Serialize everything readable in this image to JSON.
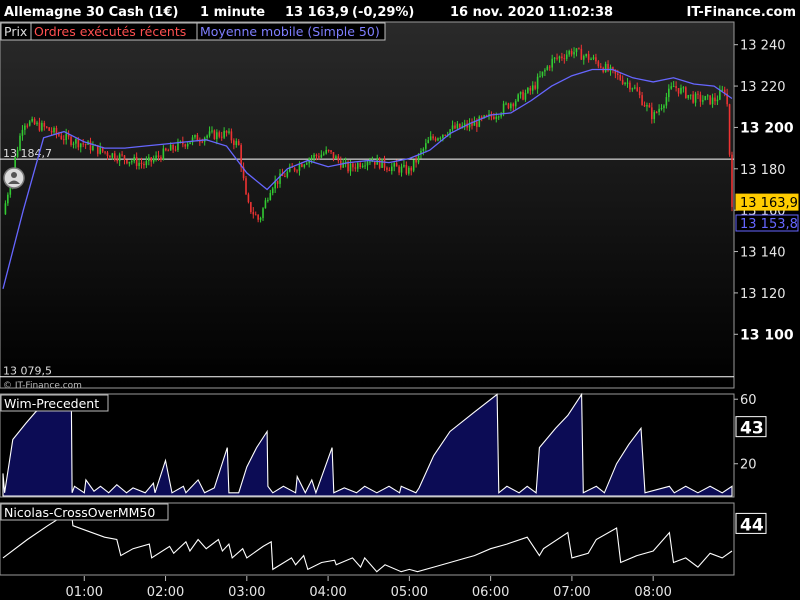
{
  "header": {
    "instrument": "Allemagne 30 Cash (1€)",
    "timeframe": "1 minute",
    "last": "13 163,9",
    "change": "(-0,29%)",
    "datetime": "16 nov. 2020 11:02:38",
    "brand": "IT-Finance.com"
  },
  "legend": {
    "price": "Prix",
    "orders": "Ordres exécutés récents",
    "ma": "Moyenne mobile (Simple 50)"
  },
  "colors": {
    "background": "#000000",
    "up_candle": "#33cc33",
    "down_candle": "#ee3333",
    "ma_line": "#6666ff",
    "orders_label": "#ff5050",
    "ma_label": "#7f7fff",
    "price_tag": "#ffcc00",
    "ma_tag": "#6666ff",
    "osc_fill": "#0c0c55"
  },
  "icons": {
    "orders_marker": "person-icon"
  },
  "copyright": "© IT-Finance.com",
  "chart_data": [
    {
      "type": "line",
      "title": "Allemagne 30 Cash (1€) · 1 minute",
      "ylim": [
        13075,
        13250
      ],
      "y_ticks": [
        "13 240",
        "13 220",
        "13 200",
        "13 180",
        "13 160",
        "13 140",
        "13 120",
        "13 100"
      ],
      "y_tick_values": [
        13240,
        13220,
        13200,
        13180,
        13160,
        13140,
        13120,
        13100
      ],
      "bold_ticks": [
        13200,
        13100
      ],
      "x_ticks": [
        "01:00",
        "02:00",
        "03:00",
        "04:00",
        "05:00",
        "06:00",
        "07:00",
        "08:00"
      ],
      "x_tick_hours": [
        1,
        2,
        3,
        4,
        5,
        6,
        7,
        8
      ],
      "x_range_hours": [
        0.0,
        8.97
      ],
      "series": [
        {
          "name": "Prix",
          "x_hours": [
            0.0,
            0.25,
            0.5,
            0.75,
            1.0,
            1.25,
            1.5,
            1.75,
            2.0,
            2.25,
            2.5,
            2.75,
            2.9,
            3.0,
            3.15,
            3.3,
            3.5,
            3.75,
            4.0,
            4.25,
            4.5,
            4.75,
            5.0,
            5.25,
            5.5,
            5.75,
            6.0,
            6.25,
            6.5,
            6.75,
            7.0,
            7.25,
            7.5,
            7.75,
            8.0,
            8.25,
            8.5,
            8.75,
            8.9,
            8.97
          ],
          "values": [
            13158,
            13203,
            13200,
            13195,
            13192,
            13188,
            13185,
            13182,
            13188,
            13193,
            13196,
            13197,
            13191,
            13163,
            13155,
            13172,
            13178,
            13185,
            13188,
            13180,
            13185,
            13181,
            13179,
            13194,
            13199,
            13201,
            13205,
            13212,
            13218,
            13232,
            13237,
            13233,
            13226,
            13220,
            13205,
            13220,
            13214,
            13213,
            13219,
            13164
          ]
        },
        {
          "name": "Moyenne mobile (Simple 50)",
          "x_hours": [
            0.0,
            0.25,
            0.5,
            0.75,
            1.0,
            1.25,
            1.5,
            1.75,
            2.0,
            2.25,
            2.5,
            2.75,
            3.0,
            3.25,
            3.5,
            3.75,
            4.0,
            4.25,
            4.5,
            4.75,
            5.0,
            5.25,
            5.5,
            5.75,
            6.0,
            6.25,
            6.5,
            6.75,
            7.0,
            7.25,
            7.5,
            7.75,
            8.0,
            8.25,
            8.5,
            8.75,
            8.97
          ],
          "values": [
            13122,
            13160,
            13195,
            13198,
            13193,
            13190,
            13190,
            13191,
            13192,
            13193,
            13194,
            13191,
            13178,
            13170,
            13180,
            13184,
            13181,
            13183,
            13184,
            13183,
            13185,
            13189,
            13197,
            13202,
            13206,
            13207,
            13213,
            13220,
            13225,
            13228,
            13228,
            13224,
            13222,
            13224,
            13221,
            13220,
            13214
          ]
        }
      ],
      "hlines": [
        {
          "value": 13184.7,
          "label": "13 184,7",
          "color": "#ffffff"
        },
        {
          "value": 13079.5,
          "label": "13 079,5",
          "color": "#ffffff"
        }
      ],
      "price_tags": [
        {
          "value": 13163.9,
          "label": "13 163,9",
          "kind": "last"
        },
        {
          "value": 13153.8,
          "label": "13 153,8",
          "kind": "ma"
        }
      ],
      "legend_position": "top-left",
      "grid": false
    },
    {
      "type": "area",
      "title": "Wim-Precedent",
      "ylim": [
        0,
        62
      ],
      "y_ticks": [
        "60",
        "20"
      ],
      "y_tick_values": [
        60,
        20
      ],
      "current_label": "43",
      "current_value": 43,
      "x_hours": [
        0.0,
        0.02,
        0.12,
        0.28,
        0.4,
        0.55,
        0.7,
        0.84,
        0.85,
        0.88,
        1.0,
        1.02,
        1.12,
        1.2,
        1.3,
        1.4,
        1.52,
        1.6,
        1.75,
        1.85,
        1.87,
        2.0,
        2.08,
        2.22,
        2.25,
        2.4,
        2.48,
        2.6,
        2.76,
        2.78,
        2.9,
        3.0,
        3.12,
        3.25,
        3.26,
        3.32,
        3.45,
        3.6,
        3.62,
        3.72,
        3.8,
        3.85,
        4.05,
        4.07,
        4.2,
        4.35,
        4.45,
        4.6,
        4.75,
        4.88,
        4.9,
        5.08,
        5.12,
        5.3,
        5.5,
        5.8,
        6.08,
        6.1,
        6.2,
        6.35,
        6.45,
        6.56,
        6.6,
        6.8,
        6.95,
        7.12,
        7.14,
        7.3,
        7.4,
        7.55,
        7.7,
        7.85,
        7.9,
        8.2,
        8.26,
        8.4,
        8.55,
        8.7,
        8.85,
        8.97
      ],
      "values": [
        14,
        2,
        35,
        45,
        52,
        57,
        62,
        62,
        2,
        6,
        2,
        10,
        3,
        6,
        2,
        7,
        2,
        5,
        2,
        8,
        2,
        22,
        2,
        6,
        2,
        10,
        2,
        5,
        30,
        2,
        2,
        18,
        30,
        40,
        6,
        2,
        6,
        2,
        12,
        2,
        10,
        2,
        30,
        2,
        5,
        2,
        6,
        2,
        6,
        2,
        6,
        2,
        5,
        25,
        40,
        52,
        63,
        2,
        6,
        2,
        6,
        2,
        30,
        42,
        50,
        63,
        2,
        6,
        2,
        20,
        32,
        42,
        2,
        6,
        2,
        6,
        2,
        6,
        2,
        6
      ]
    },
    {
      "type": "line",
      "title": "Nicolas-CrossOverMM50",
      "ylim": [
        0,
        60
      ],
      "current_label": "44",
      "current_value": 44,
      "x_hours": [
        0.0,
        0.3,
        0.55,
        0.84,
        0.86,
        1.25,
        1.4,
        1.45,
        1.6,
        1.8,
        1.83,
        2.05,
        2.1,
        2.25,
        2.3,
        2.4,
        2.5,
        2.65,
        2.7,
        2.78,
        2.82,
        2.95,
        3.0,
        3.2,
        3.3,
        3.32,
        3.55,
        3.6,
        3.7,
        3.75,
        3.92,
        4.08,
        4.1,
        4.3,
        4.4,
        4.45,
        4.6,
        4.7,
        4.9,
        5.0,
        5.1,
        5.3,
        5.5,
        5.7,
        5.8,
        6.0,
        6.2,
        6.45,
        6.6,
        6.65,
        6.95,
        7.0,
        7.2,
        7.3,
        7.55,
        7.6,
        7.8,
        8.0,
        8.2,
        8.25,
        8.4,
        8.55,
        8.7,
        8.85,
        8.97
      ],
      "values": [
        14,
        30,
        42,
        55,
        42,
        32,
        30,
        16,
        22,
        26,
        14,
        24,
        18,
        28,
        20,
        30,
        22,
        30,
        20,
        26,
        14,
        22,
        14,
        24,
        28,
        4,
        14,
        8,
        16,
        4,
        10,
        12,
        8,
        14,
        6,
        14,
        2,
        8,
        2,
        4,
        2,
        6,
        10,
        14,
        16,
        22,
        26,
        32,
        16,
        22,
        36,
        14,
        18,
        30,
        40,
        10,
        16,
        20,
        36,
        10,
        14,
        6,
        18,
        14,
        20
      ]
    }
  ]
}
